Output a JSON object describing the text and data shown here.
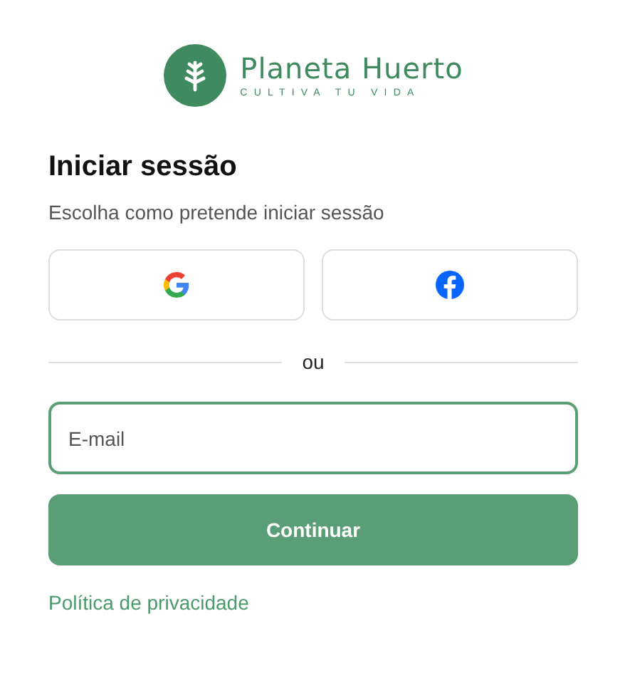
{
  "logo": {
    "name": "Planeta Huerto",
    "tagline": "CULTIVA TU VIDA"
  },
  "title": "Iniciar sessão",
  "subtitle": "Escolha como pretende iniciar sessão",
  "social_buttons": [
    {
      "kind": "google"
    },
    {
      "kind": "facebook"
    }
  ],
  "divider": "ou",
  "email_field": {
    "placeholder": "E-mail",
    "focused": true
  },
  "submit": "Continuar",
  "footer_link": "Política de privacidade"
}
